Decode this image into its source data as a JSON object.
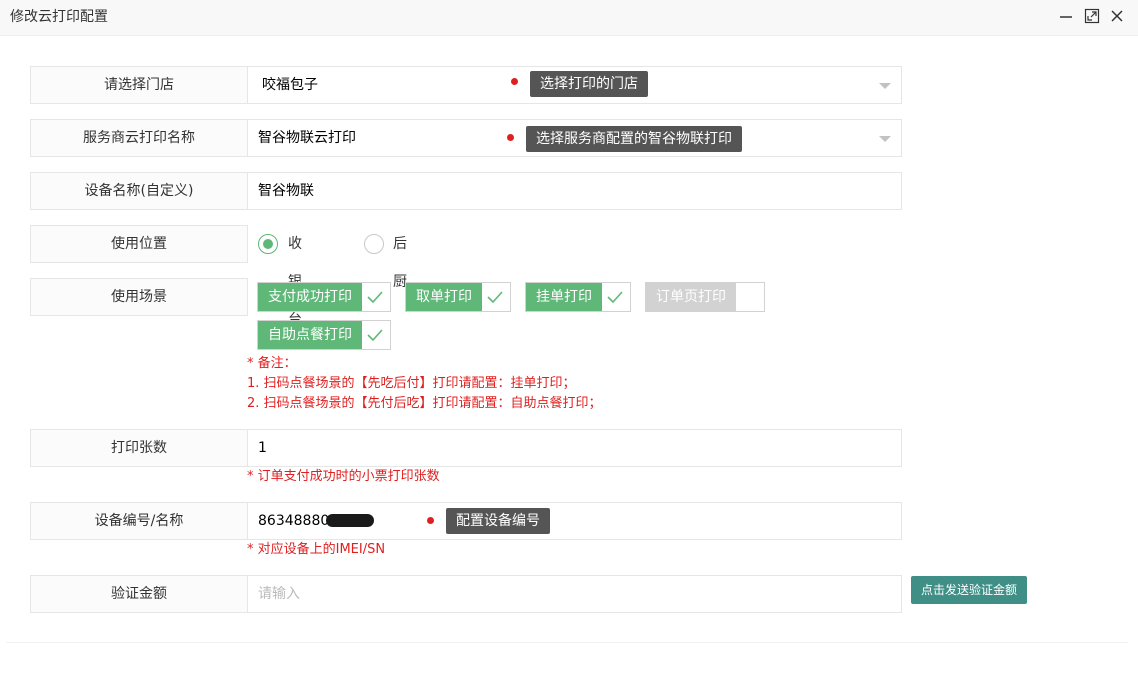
{
  "window": {
    "title": "修改云打印配置",
    "controls": [
      "minimize-icon",
      "maximize-icon",
      "close-icon"
    ]
  },
  "form": {
    "store": {
      "label": "请选择门店",
      "value": "咬福包子",
      "tooltip": "选择打印的门店"
    },
    "provider": {
      "label": "服务商云打印名称",
      "value": "智谷物联云打印",
      "tooltip": "选择服务商配置的智谷物联打印"
    },
    "device_name": {
      "label": "设备名称(自定义)",
      "value": "智谷物联"
    },
    "position": {
      "label": "使用位置",
      "options": [
        {
          "label": "收银台",
          "selected": true
        },
        {
          "label": "后厨",
          "selected": false
        }
      ]
    },
    "scenes": {
      "label": "使用场景",
      "options": [
        {
          "label": "支付成功打印",
          "checked": true
        },
        {
          "label": "取单打印",
          "checked": true
        },
        {
          "label": "挂单打印",
          "checked": true
        },
        {
          "label": "订单页打印",
          "checked": false
        },
        {
          "label": "自助点餐打印",
          "checked": true
        }
      ],
      "notes": [
        "* 备注：",
        "1. 扫码点餐场景的【先吃后付】打印请配置：挂单打印；",
        "2. 扫码点餐场景的【先付后吃】打印请配置：自助点餐打印；"
      ]
    },
    "copies": {
      "label": "打印张数",
      "value": "1",
      "note": "* 订单支付成功时的小票打印张数"
    },
    "device_id": {
      "label": "设备编号/名称",
      "value": "86348880",
      "tooltip": "配置设备编号",
      "note": "* 对应设备上的IMEI/SN"
    },
    "verify_amount": {
      "label": "验证金额",
      "placeholder": "请输入",
      "button": "点击发送验证金额"
    }
  },
  "colors": {
    "accent": "#5fb878",
    "button": "#3f8f87",
    "note": "#e02020",
    "tooltip": "#555555"
  }
}
